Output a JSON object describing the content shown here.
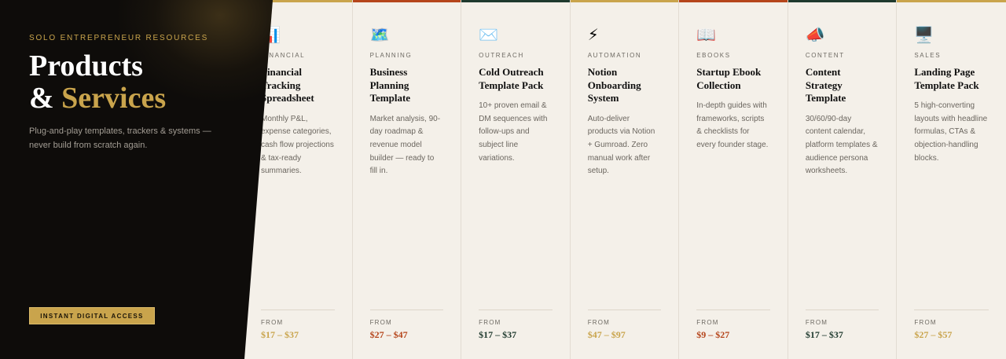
{
  "hero": {
    "eyebrow": "SOLO ENTREPRENEUR RESOURCES",
    "title_line1": "Products",
    "title_amp": "& ",
    "title_accent": "Services",
    "subtitle": "Plug-and-play templates, trackers & systems — never build from scratch again.",
    "cta_label": "INSTANT DIGITAL ACCESS"
  },
  "colors": {
    "gold": "#c9a44c",
    "rust": "#b5451b",
    "forest": "#1f3a2e",
    "dark_panel": "#0e0c0a",
    "card_bg": "#f4f0e9"
  },
  "from_label": "FROM",
  "products": [
    {
      "icon": "📊",
      "icon_name": "bar-chart-icon",
      "category": "FINANCIAL",
      "title": "Financial Tracking Spreadsheet",
      "description": "Monthly P&L, expense categories, cash flow projections & tax-ready summaries.",
      "price": "$17 – $37",
      "accent": "#c9a44c"
    },
    {
      "icon": "🗺️",
      "icon_name": "map-icon",
      "category": "PLANNING",
      "title": "Business Planning Template",
      "description": "Market analysis, 90-day roadmap & revenue model builder — ready to fill in.",
      "price": "$27 – $47",
      "accent": "#b5451b"
    },
    {
      "icon": "✉️",
      "icon_name": "envelope-icon",
      "category": "OUTREACH",
      "title": "Cold Outreach Template Pack",
      "description": "10+ proven email & DM sequences with follow-ups and subject line variations.",
      "price": "$17 – $37",
      "accent": "#1f3a2e"
    },
    {
      "icon": "⚡",
      "icon_name": "lightning-icon",
      "category": "AUTOMATION",
      "title": "Notion Onboarding System",
      "description": "Auto-deliver products via Notion + Gumroad. Zero manual work after setup.",
      "price": "$47 – $97",
      "accent": "#c9a44c"
    },
    {
      "icon": "📖",
      "icon_name": "book-icon",
      "category": "EBOOKS",
      "title": "Startup Ebook Collection",
      "description": "In-depth guides with frameworks, scripts & checklists for every founder stage.",
      "price": "$9 – $27",
      "accent": "#b5451b"
    },
    {
      "icon": "📣",
      "icon_name": "megaphone-icon",
      "category": "CONTENT",
      "title": "Content Strategy Template",
      "description": "30/60/90-day content calendar, platform templates & audience persona worksheets.",
      "price": "$17 – $37",
      "accent": "#1f3a2e"
    },
    {
      "icon": "🖥️",
      "icon_name": "desktop-icon",
      "category": "SALES",
      "title": "Landing Page Template Pack",
      "description": "5 high-converting layouts with headline formulas, CTAs & objection-handling blocks.",
      "price": "$27 – $57",
      "accent": "#c9a44c"
    }
  ]
}
